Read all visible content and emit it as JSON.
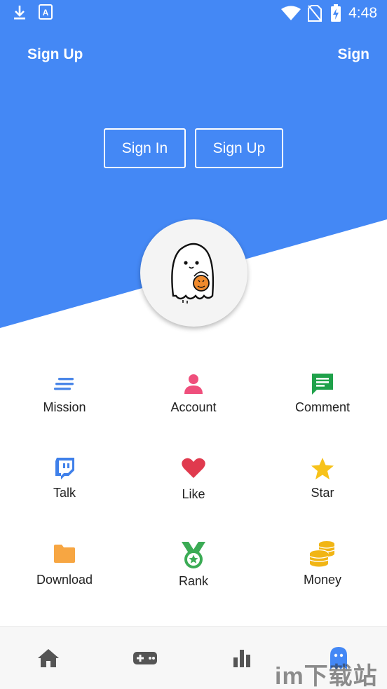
{
  "status_bar": {
    "time": "4:48",
    "icons": [
      "download-icon",
      "font-app-icon",
      "wifi-icon",
      "no-sim-icon",
      "battery-charging-icon"
    ]
  },
  "header": {
    "left_link": "Sign Up",
    "right_link": "Sign"
  },
  "auth": {
    "sign_in": "Sign In",
    "sign_up": "Sign Up"
  },
  "avatar": {
    "icon": "ghost-pumpkin-icon"
  },
  "grid": [
    {
      "label": "Mission",
      "icon": "list-lines-icon",
      "color": "#4a86e8"
    },
    {
      "label": "Account",
      "icon": "person-icon",
      "color": "#ef4f7c"
    },
    {
      "label": "Comment",
      "icon": "comment-icon",
      "color": "#1fa14a"
    },
    {
      "label": "Talk",
      "icon": "twitch-icon",
      "color": "#3f80ea"
    },
    {
      "label": "Like",
      "icon": "heart-icon",
      "color": "#e03a4e"
    },
    {
      "label": "Star",
      "icon": "star-icon",
      "color": "#f7c21a"
    },
    {
      "label": "Download",
      "icon": "folder-icon",
      "color": "#f7a642"
    },
    {
      "label": "Rank",
      "icon": "medal-icon",
      "color": "#3bab55"
    },
    {
      "label": "Money",
      "icon": "coins-icon",
      "color": "#f1b514"
    }
  ],
  "bottom_nav": [
    {
      "name": "home",
      "icon": "home-icon"
    },
    {
      "name": "games",
      "icon": "gamepad-icon"
    },
    {
      "name": "stats",
      "icon": "bar-chart-icon"
    },
    {
      "name": "profile",
      "icon": "ghost-icon",
      "active": true
    }
  ],
  "watermark": "im下载站",
  "colors": {
    "primary": "#4488f5",
    "nav_inactive": "#555555"
  }
}
